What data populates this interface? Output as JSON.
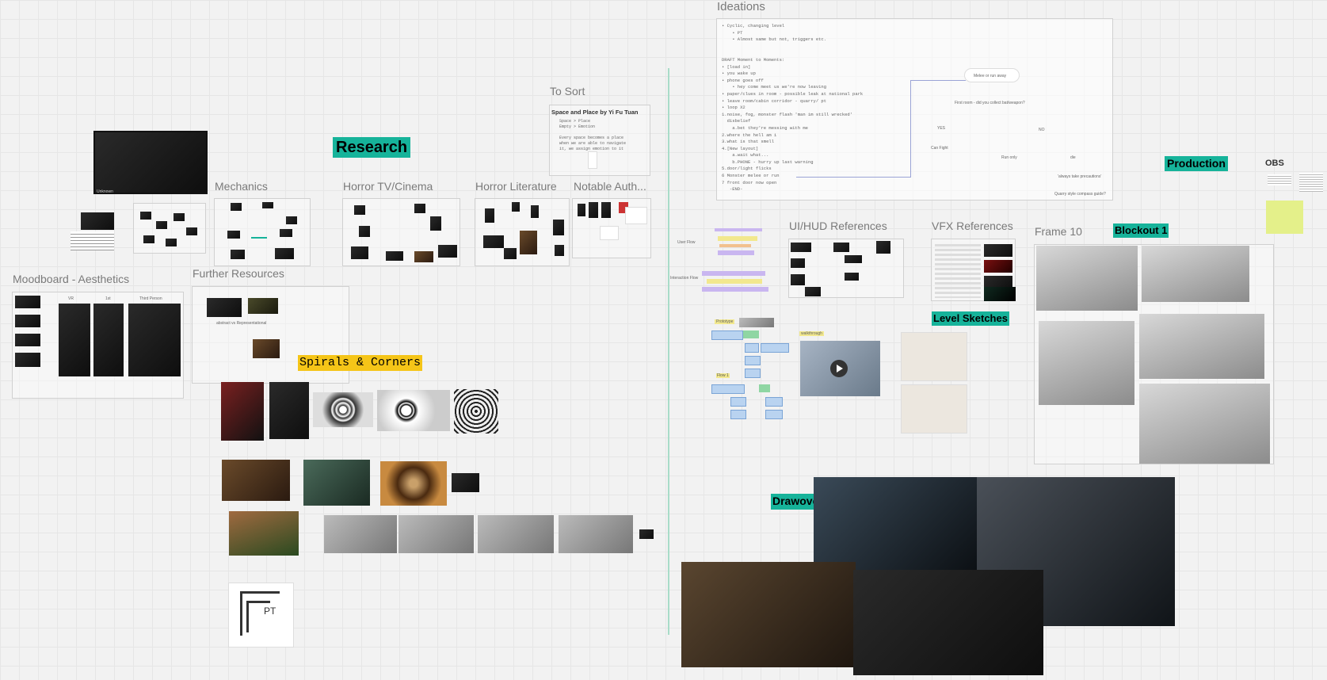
{
  "titles": {
    "ideations": "Ideations",
    "to_sort": "To Sort",
    "mechanics": "Mechanics",
    "horror_tv": "Horror TV/Cinema",
    "horror_lit": "Horror Literature",
    "notable_auth": "Notable Auth...",
    "moodboard": "Moodboard - Aesthetics",
    "further_resources": "Further Resources",
    "ui_hud": "UI/HUD References",
    "vfx": "VFX References",
    "frame10": "Frame 10"
  },
  "tags": {
    "research": "Research",
    "production": "Production",
    "blockout": "Blockout 1",
    "level_sketches": "Level Sketches",
    "drawovers": "Drawovers",
    "spirals": "Spirals & Corners",
    "obs": "OBS"
  },
  "to_sort_note": {
    "heading": "Space and Place by Yi Fu Tuan",
    "lines": "Space > Place\nEmpty > Emotion\n\nEvery space becomes a place\nwhen we are able to navigate\nit, we assign emotion to it"
  },
  "ideations_text": "• Cyclic, changing level\n    • PT\n    • Almost same but not, triggers etc.\n\n\nDRAFT Moment to Moments:\n• [load in]\n• you wake up\n• phone goes off\n    • hey come meet us we're now leaving\n• paper/clues in room - possible leak at national park\n• leave room/cabin corridor - quarry/ pt\n• loop X2\n1.noise, fog, monster flash 'man im still wrecked'\n  disbelief\n    a.bet they're messing with me\n2.where the hell am i\n3.what is that smell\n4.[New layout]\n    a.wait what...\n    b.PHONE - hurry up last warning\n5.door/light flicks\n6 Monster melee or run\n7 front door now open\n   -END-",
  "decision_tree": {
    "root": "Melee or run away",
    "q1": "First room - did you collect bat/weapon?",
    "yes": "YES",
    "no": "NO",
    "can_fight": "Can Fight",
    "run_only": "Run only",
    "die": "die",
    "note": "'always take precautions'",
    "footer": "Quarry style compass guide?"
  },
  "moodboard_cols": [
    "VR",
    "1st",
    "Third Person"
  ],
  "further_caption": "abstract vs Representational",
  "pt_label": "PT",
  "small_labels": {
    "unknown_film": "Unknown",
    "prototype": "Prototype",
    "walkthrough": "walkthrough",
    "flow1": "Flow 1",
    "user_flow": "User Flow",
    "interaction_flow": "Interaction Flow"
  },
  "colors": {
    "teal": "#16b39a",
    "yellow": "#f5c518",
    "canvas": "#f2f2f2",
    "divider": "#9ed9c4"
  }
}
